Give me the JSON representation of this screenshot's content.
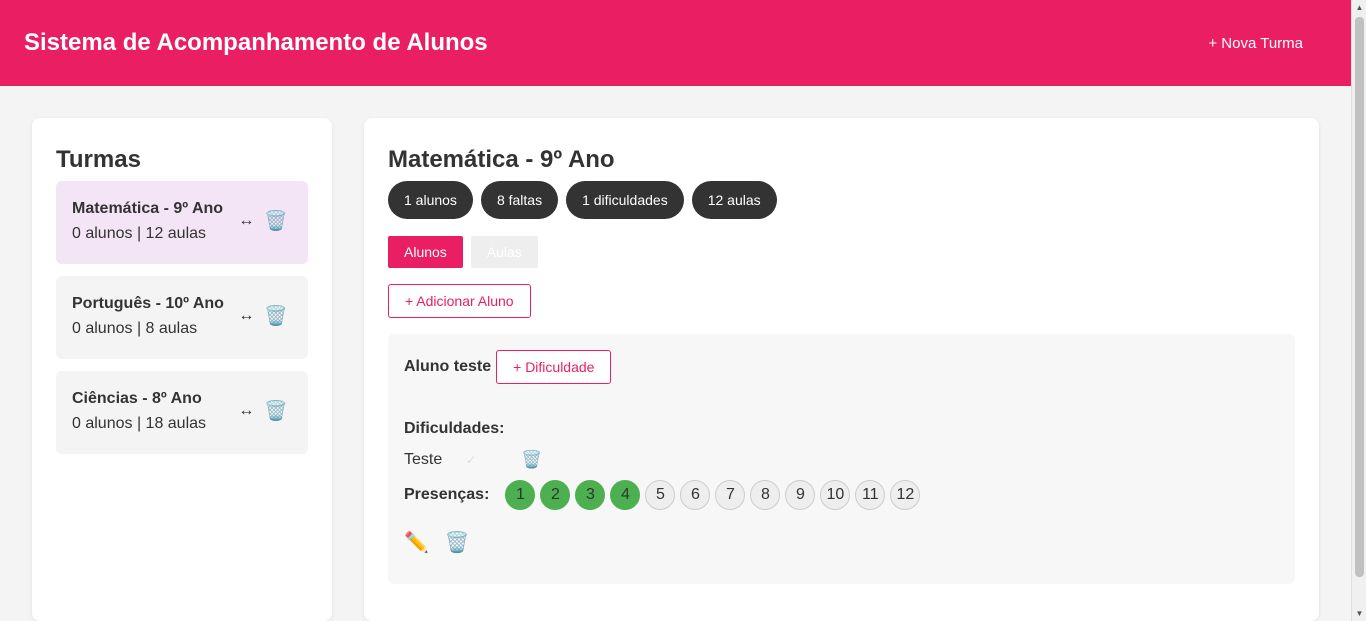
{
  "header": {
    "title": "Sistema de Acompanhamento de Alunos",
    "new_class_label": "+ Nova Turma"
  },
  "sidebar": {
    "title": "Turmas",
    "items": [
      {
        "name": "Matemática - 9º Ano",
        "info": "0 alunos | 12 aulas",
        "move": "↔",
        "trash": "🗑️"
      },
      {
        "name": "Português - 10º Ano",
        "info": "0 alunos | 8 aulas",
        "move": "↔",
        "trash": "🗑️"
      },
      {
        "name": "Ciências - 8º Ano",
        "info": "0 alunos | 18 aulas",
        "move": "↔",
        "trash": "🗑️"
      }
    ]
  },
  "main": {
    "title": "Matemática - 9º Ano",
    "stats": [
      "1 alunos",
      "8 faltas",
      "1 dificuldades",
      "12 aulas"
    ],
    "tabs": [
      "Alunos",
      "Aulas"
    ],
    "add_student_label": "+ Adicionar Aluno",
    "student": {
      "name": "Aluno teste",
      "add_difficulty_label": "+ Dificuldade",
      "difficulties_title": "Dificuldades:",
      "difficulty": "Teste",
      "check_icon": "✓",
      "trash_icon": "🗑️",
      "presences_label": "Presenças:",
      "lessons": [
        "1",
        "2",
        "3",
        "4",
        "5",
        "6",
        "7",
        "8",
        "9",
        "10",
        "11",
        "12"
      ],
      "present_count": 4,
      "edit_icon": "✏️",
      "delete_icon": "🗑️"
    }
  },
  "colors": {
    "primary": "#e91e63",
    "present": "#4caf50",
    "dark": "#333333",
    "active_bg": "#f3e5f5"
  }
}
